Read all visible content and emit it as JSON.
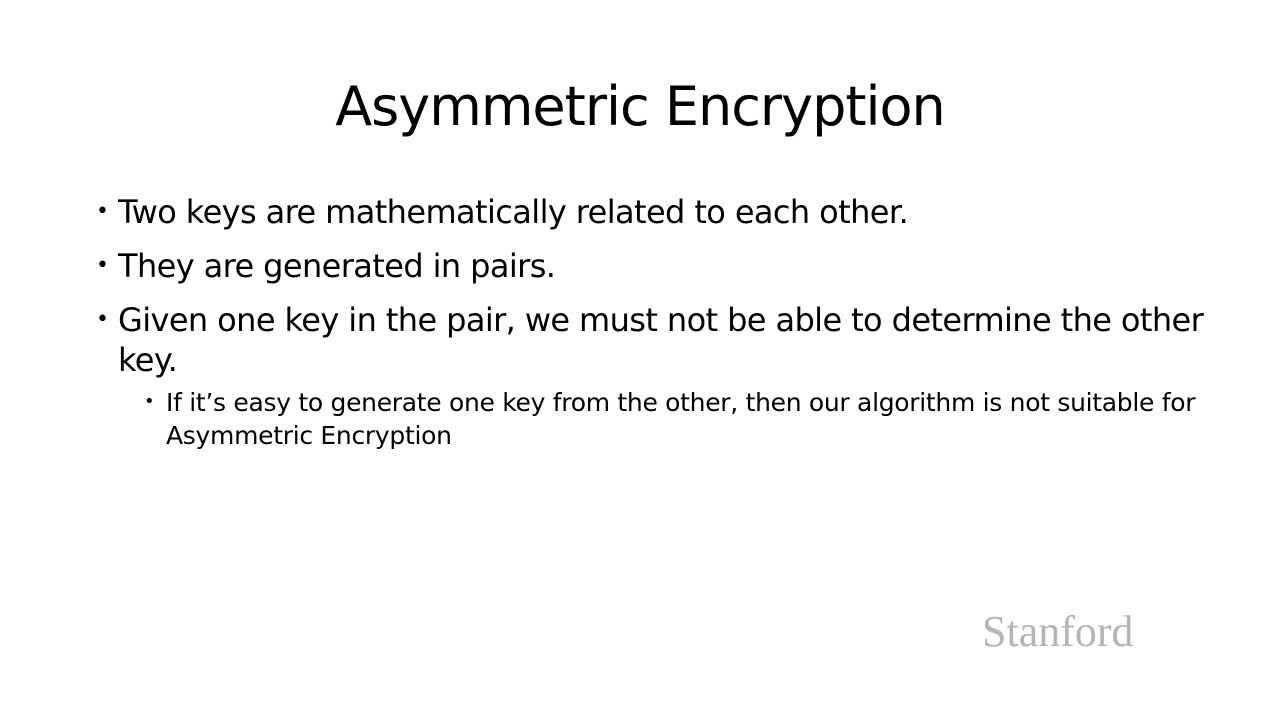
{
  "slide": {
    "title": "Asymmetric Encryption",
    "bullets": [
      {
        "marker": "•",
        "text": "Two keys are mathematically related to each other."
      },
      {
        "marker": "•",
        "text": "They are generated in pairs."
      },
      {
        "marker": "•",
        "text": "Given one key in the pair, we must not be able to determine the other key."
      }
    ],
    "sub_bullets": [
      {
        "marker": "•",
        "text": "If it’s easy to generate one key from the other, then our algorithm is not suitable for Asymmetric Encryption"
      }
    ],
    "logo_text": "Stanford",
    "colors": {
      "background": "#ffffff",
      "text": "#000000",
      "logo": "#b5b5b5"
    }
  }
}
